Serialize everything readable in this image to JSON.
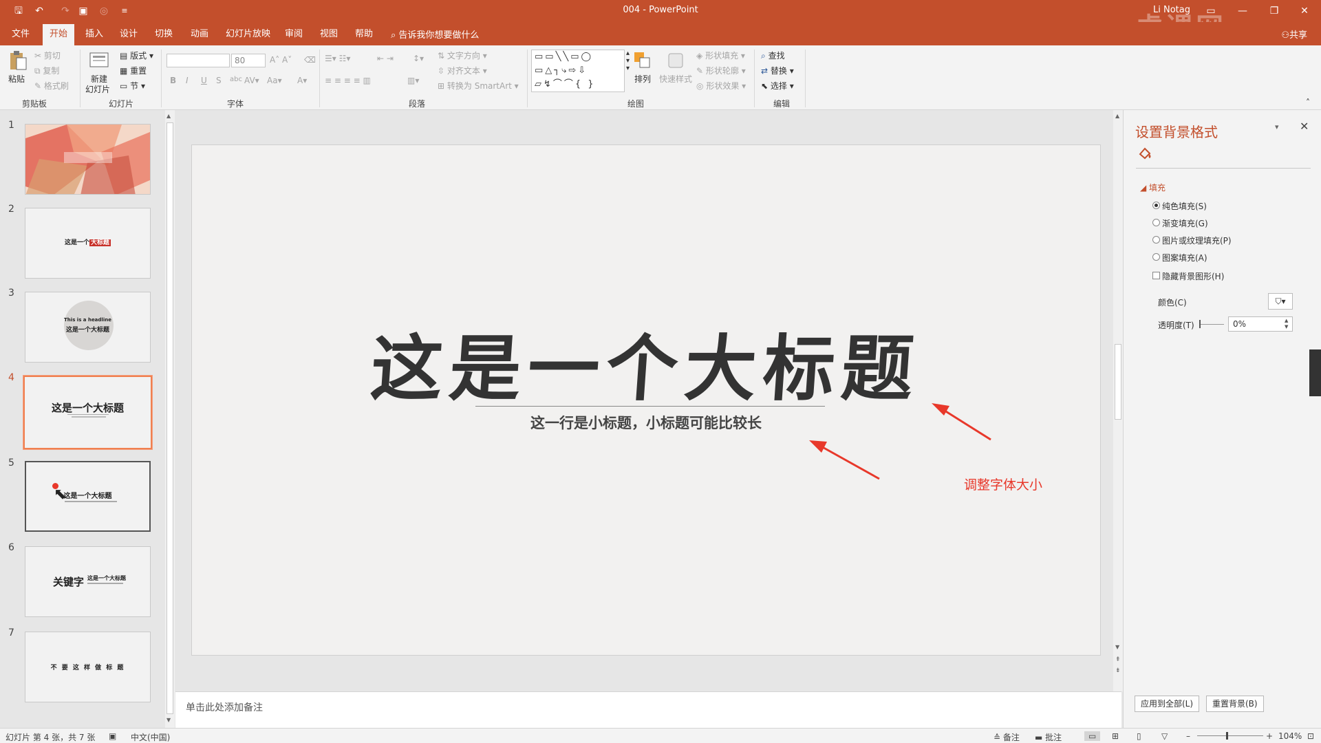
{
  "titlebar": {
    "doc_title": "004  -  PowerPoint",
    "user": "Li Notag",
    "watermark": "虎课网"
  },
  "tabs": [
    {
      "label": "文件"
    },
    {
      "label": "开始"
    },
    {
      "label": "插入"
    },
    {
      "label": "设计"
    },
    {
      "label": "切换"
    },
    {
      "label": "动画"
    },
    {
      "label": "幻灯片放映"
    },
    {
      "label": "审阅"
    },
    {
      "label": "视图"
    },
    {
      "label": "帮助"
    }
  ],
  "tellme": "告诉我你想要做什么",
  "share": "共享",
  "ribbon": {
    "clipboard": {
      "paste": "粘贴",
      "cut": "剪切",
      "copy": "复制",
      "painter": "格式刷",
      "label": "剪贴板"
    },
    "slides": {
      "new_slide": "新建",
      "new_slide2": "幻灯片",
      "layout": "版式",
      "reset": "重置",
      "section": "节",
      "label": "幻灯片"
    },
    "font": {
      "font_name": "",
      "font_size": "80",
      "label": "字体"
    },
    "paragraph": {
      "text_dir": "文字方向",
      "align_text": "对齐文本",
      "smartart": "转换为 SmartArt",
      "label": "段落"
    },
    "drawing": {
      "arrange": "排列",
      "quick_styles": "快速样式",
      "shape_fill": "形状填充",
      "shape_outline": "形状轮廓",
      "shape_effects": "形状效果",
      "label": "绘图"
    },
    "editing": {
      "find": "查找",
      "replace": "替换",
      "select": "选择",
      "label": "编辑"
    }
  },
  "slides": [
    {
      "num": "1"
    },
    {
      "num": "2",
      "text_a": "这是一个",
      "text_b": "大标题"
    },
    {
      "num": "3",
      "en": "This is a headline",
      "zh": "这是一个大标题"
    },
    {
      "num": "4",
      "title": "这是一个大标题"
    },
    {
      "num": "5",
      "title": "这是一个大标题"
    },
    {
      "num": "6",
      "key": "关键字",
      "title": "这是一个大标题"
    },
    {
      "num": "7",
      "title": "不 要 这 样 做 标 题"
    }
  ],
  "slide": {
    "title": "这是一个大标题",
    "subtitle": "这一行是小标题，小标题可能比较长"
  },
  "annotation": "调整字体大小",
  "notes_placeholder": "单击此处添加备注",
  "format_pane": {
    "title": "设置背景格式",
    "section": "填充",
    "options": [
      "纯色填充(S)",
      "渐变填充(G)",
      "图片或纹理填充(P)",
      "图案填充(A)"
    ],
    "hide_bg": "隐藏背景图形(H)",
    "color_label": "颜色(C)",
    "transparency_label": "透明度(T)",
    "transparency_value": "0%",
    "apply_all": "应用到全部(L)",
    "reset_bg": "重置背景(B)"
  },
  "statusbar": {
    "slide_info": "幻灯片 第 4 张，共 7 张",
    "language": "中文(中国)",
    "notes": "备注",
    "comments": "批注",
    "zoom": "104%"
  },
  "colors": {
    "accent": "#c34f2c",
    "annotation_red": "#e8382a"
  }
}
